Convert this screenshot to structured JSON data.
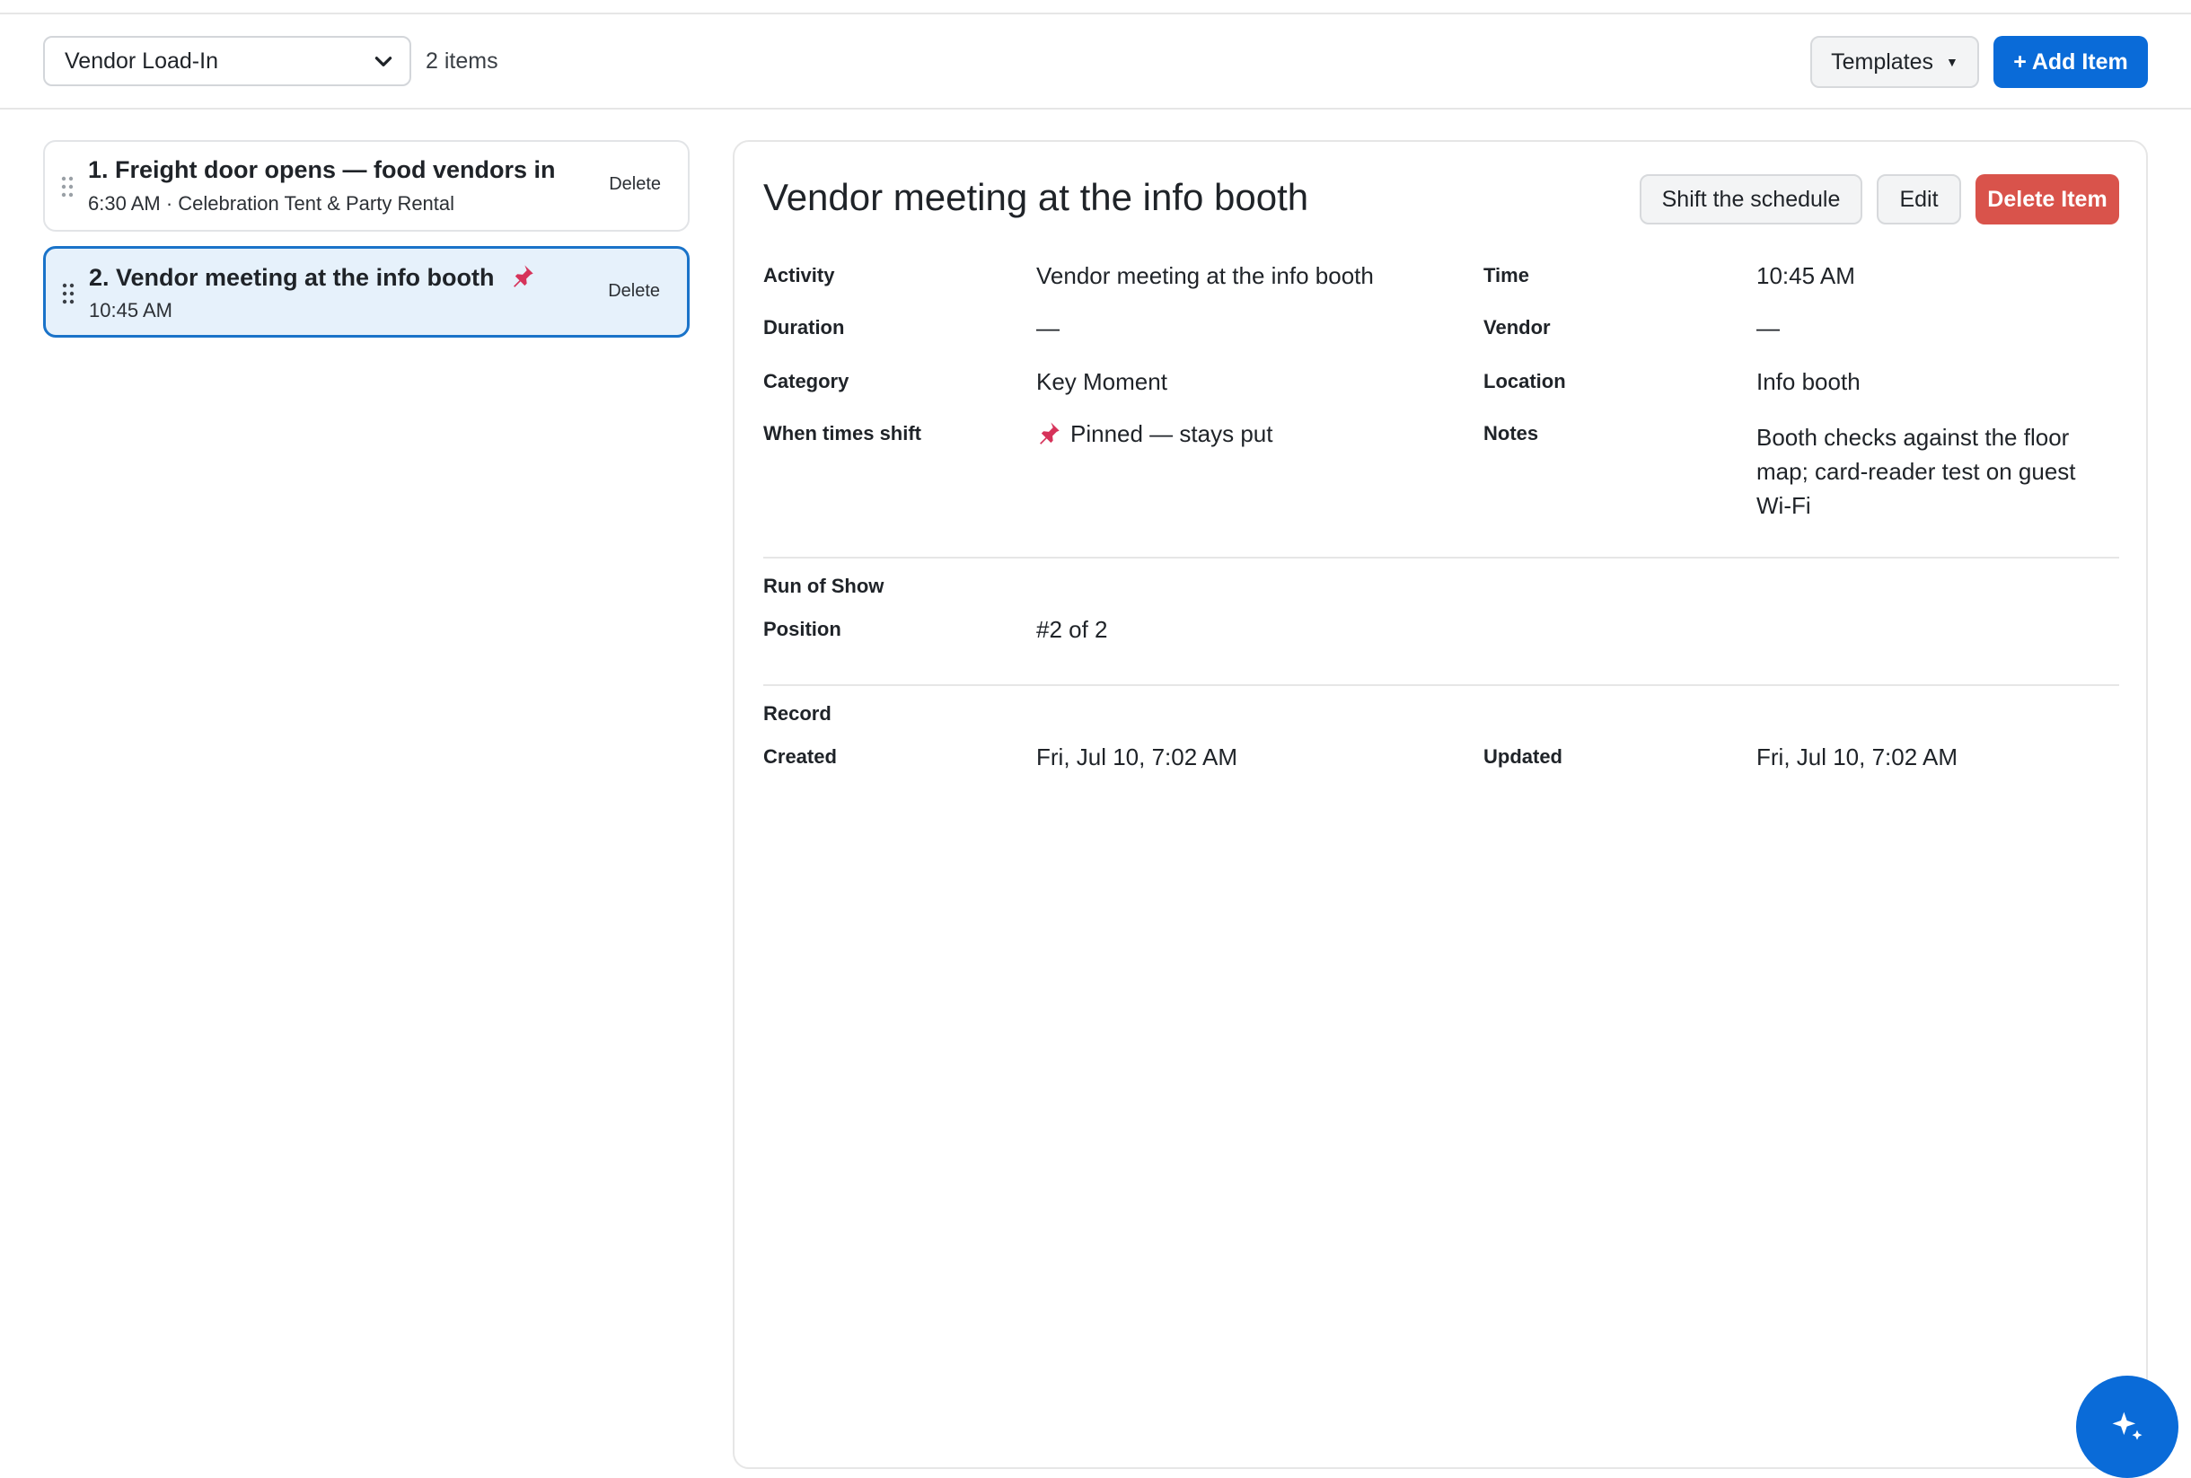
{
  "toolbar": {
    "list_select": "Vendor Load-In",
    "item_count": "2 items",
    "templates_label": "Templates",
    "add_item_label": "+ Add Item"
  },
  "list": [
    {
      "title": "1. Freight door opens — food vendors in",
      "subtitle": "6:30 AM · Celebration Tent & Party Rental",
      "pinned": false,
      "delete_label": "Delete",
      "selected": false
    },
    {
      "title": "2. Vendor meeting at the info booth",
      "subtitle": "10:45 AM",
      "pinned": true,
      "delete_label": "Delete",
      "selected": true
    }
  ],
  "detail": {
    "title": "Vendor meeting at the info booth",
    "shift_label": "Shift the schedule",
    "edit_label": "Edit",
    "delete_label": "Delete Item",
    "fields": {
      "activity_label": "Activity",
      "activity": "Vendor meeting at the info booth",
      "time_label": "Time",
      "time": "10:45 AM",
      "duration_label": "Duration",
      "duration": "—",
      "vendor_label": "Vendor",
      "vendor": "—",
      "category_label": "Category",
      "category": "Key Moment",
      "location_label": "Location",
      "location": "Info booth",
      "shift_label": "When times shift",
      "shift": "Pinned — stays put",
      "notes_label": "Notes",
      "notes": "Booth checks against the floor map; card-reader test on guest Wi-Fi"
    },
    "run_of_show": {
      "section": "Run of Show",
      "position_label": "Position",
      "position": "#2 of 2"
    },
    "record": {
      "section": "Record",
      "created_label": "Created",
      "created": "Fri, Jul 10, 7:02 AM",
      "updated_label": "Updated",
      "updated": "Fri, Jul 10, 7:02 AM"
    }
  },
  "colors": {
    "primary": "#0a6bd8",
    "danger": "#d9534b",
    "selected_bg": "#e6f1fb",
    "pin": "#d6335a"
  },
  "icons": [
    "chevron-down-icon",
    "caret-down-icon",
    "drag-handle-icon",
    "pin-icon",
    "sparkle-icon"
  ]
}
